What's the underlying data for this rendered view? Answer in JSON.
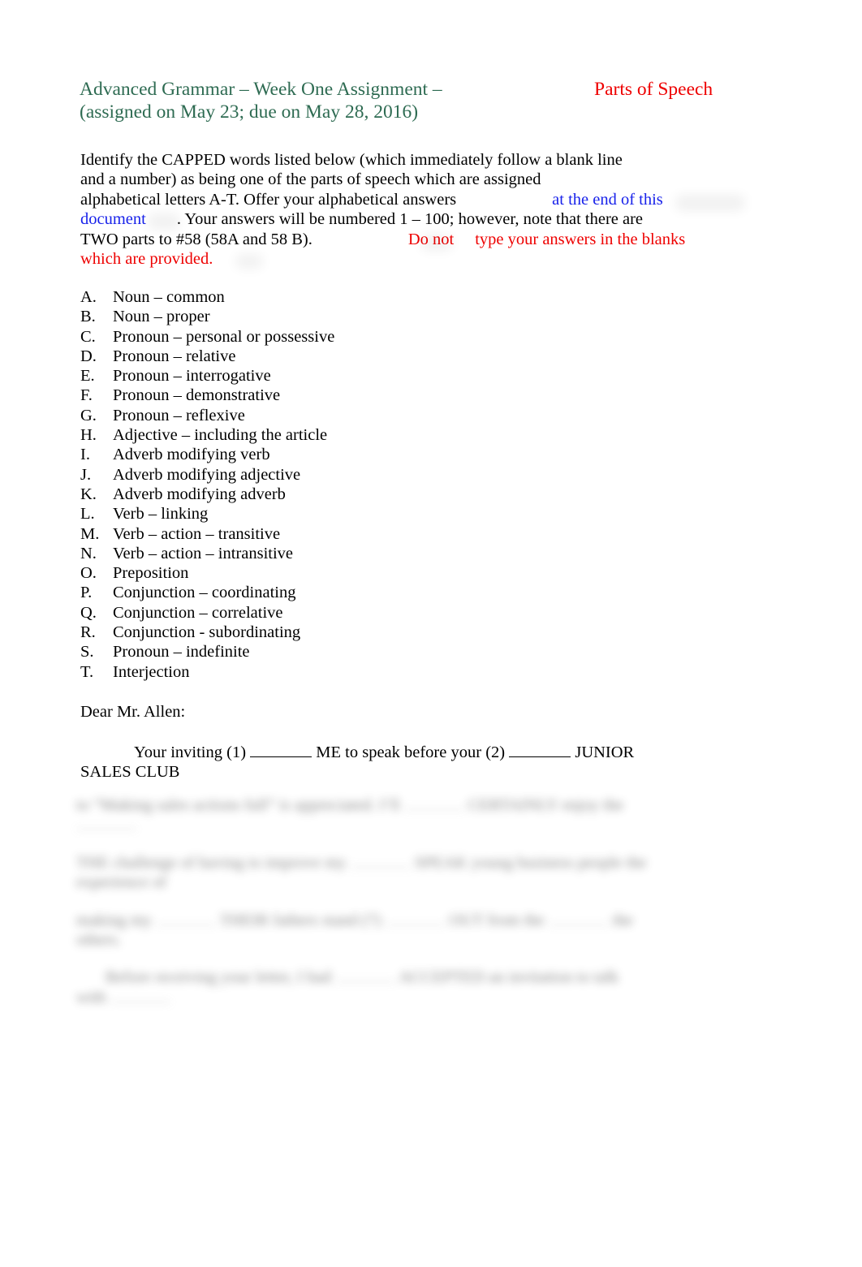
{
  "document": {
    "header": {
      "title_line_1": "Advanced Grammar – Week One Assignment –",
      "title_line_2": "(assigned on May 23; due on May 28, 2016)",
      "title_right": "Parts of Speech",
      "title_color": "#2e6b52",
      "title_right_color": "#ee0000"
    },
    "intro": {
      "line_1": "Identify the CAPPED words listed below (which immediately follow a blank line",
      "line_2": "and a number) as being one of the parts of speech which are assigned",
      "line_3_a": "alphabetical letters A-T. Offer your alphabetical answers",
      "line_3_b": "at the end of this",
      "line_4_a": "document",
      "line_4_b": ". Your answers will be numbered 1 – 100; however, note that there are",
      "line_5_a": "TWO parts to #58 (58A and 58 B).",
      "line_5_b": "Do not",
      "line_5_c": "type your answers in the blanks",
      "line_6": "which are provided.",
      "link_color": "#1822ea",
      "emphasis_color": "#ee0000"
    },
    "parts_of_speech": [
      {
        "letter": "A.",
        "label": "Noun – common"
      },
      {
        "letter": "B.",
        "label": "Noun – proper"
      },
      {
        "letter": "C.",
        "label": "Pronoun – personal or possessive"
      },
      {
        "letter": "D.",
        "label": "Pronoun – relative"
      },
      {
        "letter": "E.",
        "label": "Pronoun – interrogative"
      },
      {
        "letter": "F.",
        "label": "Pronoun – demonstrative"
      },
      {
        "letter": "G.",
        "label": "Pronoun – reflexive"
      },
      {
        "letter": "H.",
        "label": "Adjective – including the article"
      },
      {
        "letter": "I.",
        "label": "Adverb modifying verb"
      },
      {
        "letter": "J.",
        "label": "Adverb modifying adjective"
      },
      {
        "letter": "K.",
        "label": "Adverb modifying adverb"
      },
      {
        "letter": "L.",
        "label": "Verb – linking"
      },
      {
        "letter": "M.",
        "label": "Verb – action – transitive"
      },
      {
        "letter": "N.",
        "label": "Verb – action – intransitive"
      },
      {
        "letter": "O.",
        "label": "Preposition"
      },
      {
        "letter": "P.",
        "label": "Conjunction – coordinating"
      },
      {
        "letter": "Q.",
        "label": "Conjunction – correlative"
      },
      {
        "letter": "R.",
        "label": "Conjunction - subordinating"
      },
      {
        "letter": "S.",
        "label": "Pronoun – indefinite"
      },
      {
        "letter": "T.",
        "label": "Interjection"
      }
    ],
    "letter": {
      "salutation": "Dear Mr. Allen:",
      "body_line_1_a": "Your inviting (1)",
      "body_line_1_b": "ME to speak before your (2)",
      "body_line_1_c": "JUNIOR",
      "body_line_2": "SALES CLUB"
    },
    "redacted": {
      "note": "blurred / illegible text block",
      "lines": [
        "at ——— ———— ——— —— ————— (3)",
        "——————",
        "(4) ————— —— ————— (5)",
        "————— (7)",
        "——— (8) ———— ————— (9)",
        "——— ————— ——— (11)",
        "———"
      ]
    }
  }
}
